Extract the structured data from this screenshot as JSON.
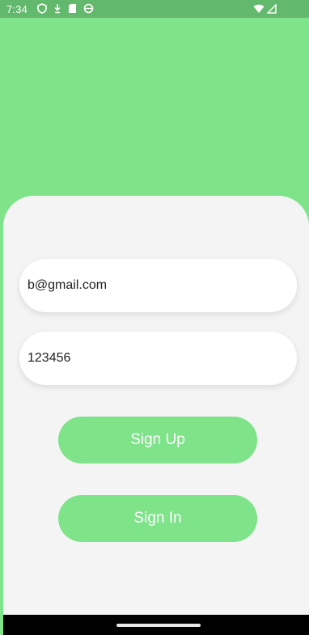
{
  "status_bar": {
    "time": "7:34",
    "left_icons": [
      "shield-icon",
      "download-icon",
      "sd-card-icon",
      "circle-icon"
    ],
    "right_icons": [
      "wifi-icon",
      "signal-icon"
    ]
  },
  "form": {
    "email": {
      "value": "b@gmail.com",
      "placeholder": ""
    },
    "password": {
      "value": "123456",
      "placeholder": ""
    }
  },
  "buttons": {
    "sign_up": "Sign Up",
    "sign_in": "Sign In"
  },
  "colors": {
    "accent": "#7ee389",
    "status_bar": "#62b86c",
    "card": "#f4f4f4"
  }
}
